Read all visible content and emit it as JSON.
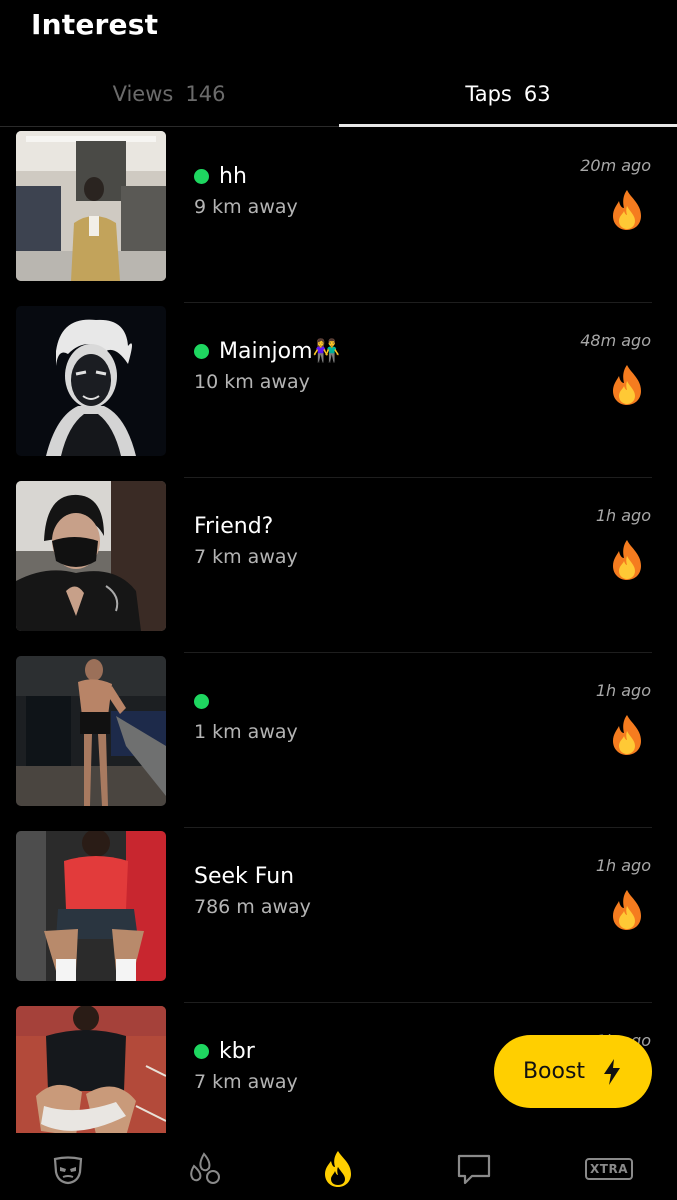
{
  "header": {
    "title": "Interest"
  },
  "tabs": [
    {
      "label": "Views",
      "count": "146",
      "active": false
    },
    {
      "label": "Taps",
      "count": "63",
      "active": true
    }
  ],
  "taps": [
    {
      "name": "hh",
      "online": true,
      "distance": "9 km away",
      "time": "20m ago"
    },
    {
      "name": "Mainjom👫",
      "online": true,
      "distance": "10 km away",
      "time": "48m ago"
    },
    {
      "name": "Friend?",
      "online": false,
      "distance": "7 km away",
      "time": "1h ago"
    },
    {
      "name": "",
      "online": true,
      "distance": "1 km away",
      "time": "1h ago"
    },
    {
      "name": "Seek Fun",
      "online": false,
      "distance": "786 m away",
      "time": "1h ago"
    },
    {
      "name": "kbr",
      "online": true,
      "distance": "7 km away",
      "time": "1h ago"
    }
  ],
  "boost": {
    "label": "Boost",
    "icon": "lightning-bolt-icon"
  },
  "bottom_nav": [
    {
      "icon": "mask-icon"
    },
    {
      "icon": "drops-icon"
    },
    {
      "icon": "flame-icon",
      "active": true
    },
    {
      "icon": "chat-icon"
    },
    {
      "icon": "xtra-icon",
      "label": "XTRA"
    }
  ],
  "colors": {
    "online": "#1ed760",
    "boost": "#ffcf00",
    "background": "#000000"
  }
}
